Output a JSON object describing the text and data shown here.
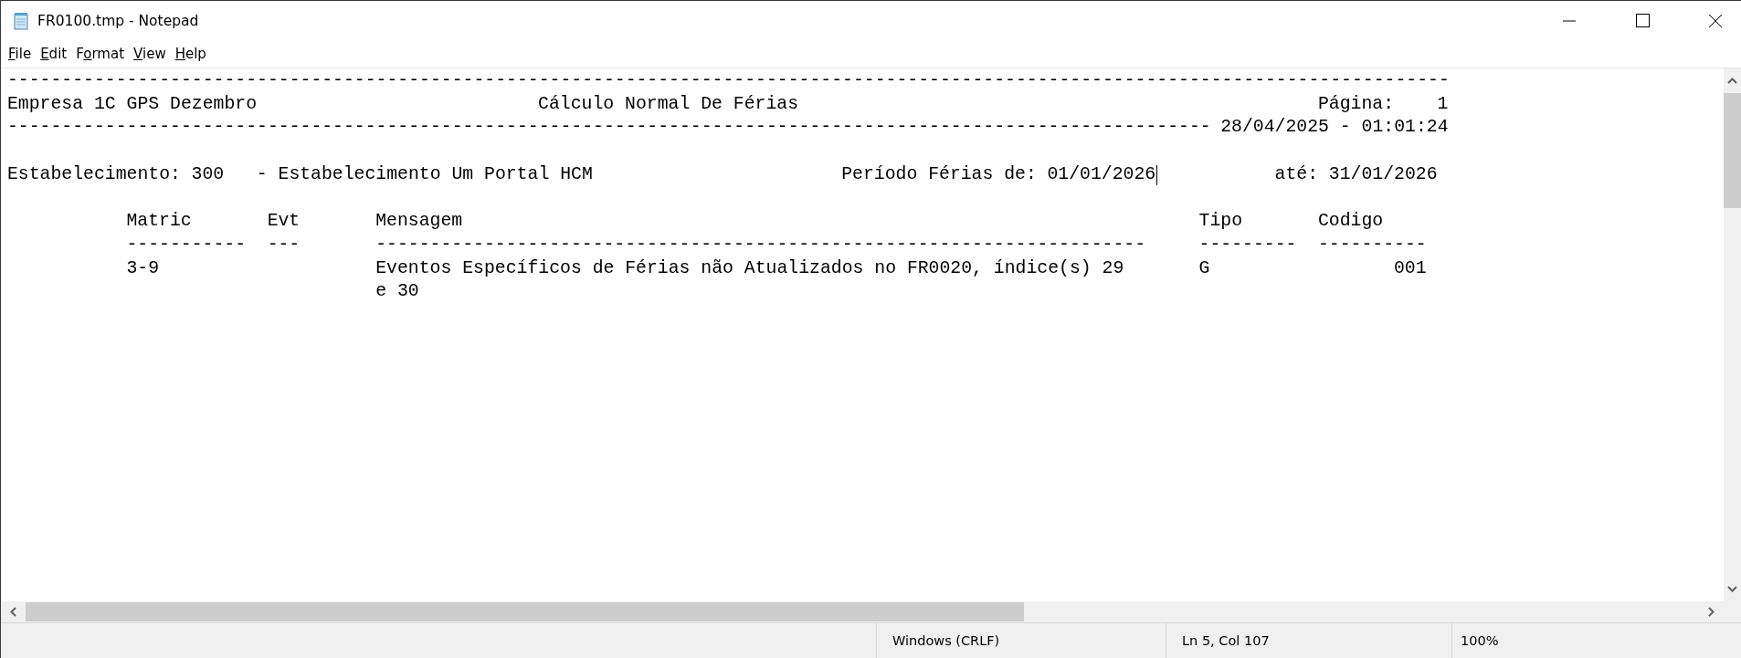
{
  "window": {
    "title": "FR0100.tmp - Notepad"
  },
  "menu": [
    {
      "access_key": "F",
      "rest": "ile"
    },
    {
      "access_key": "E",
      "rest": "dit"
    },
    {
      "lead": "F",
      "access_key": "o",
      "rest": "rmat"
    },
    {
      "access_key": "V",
      "rest": "iew"
    },
    {
      "access_key": "H",
      "rest": "elp"
    }
  ],
  "report": {
    "rule_top": "-------------------------------------------------------------------------------------------------------------------------------------",
    "company": "Empresa 1C GPS Dezembro",
    "title": "Cálculo Normal De Férias",
    "page_label": "Página:",
    "page_number": "1",
    "rule_date": "---------------------------------------------------------------------------------------------------------------",
    "timestamp": "28/04/2025 - 01:01:24",
    "establishment_label": "Estabelecimento:",
    "establishment_code": "300",
    "establishment_name": "- Estabelecimento Um Portal HCM",
    "period": {
      "label": "Período Férias de:",
      "start": "01/01/2026",
      "caret": true,
      "end_label": "até:",
      "end": "31/01/2026"
    },
    "columns": [
      {
        "header": "Matric",
        "rule": "-----------"
      },
      {
        "header": "Evt",
        "rule": "---"
      },
      {
        "header": "Mensagem",
        "rule": "-----------------------------------------------------------------------"
      },
      {
        "header": "Tipo",
        "rule": "---------"
      },
      {
        "header": "Codigo",
        "rule": "----------"
      }
    ],
    "rows": [
      {
        "matric": "3-9",
        "message": [
          "Eventos Específicos de Férias não Atualizados no FR0020, índice(s) 29",
          "e 30"
        ],
        "tipo": "G",
        "codigo": "001"
      }
    ]
  },
  "status_bar": {
    "line_ending": "Windows (CRLF)",
    "position": "Ln 5, Col 107",
    "zoom": "100%"
  }
}
